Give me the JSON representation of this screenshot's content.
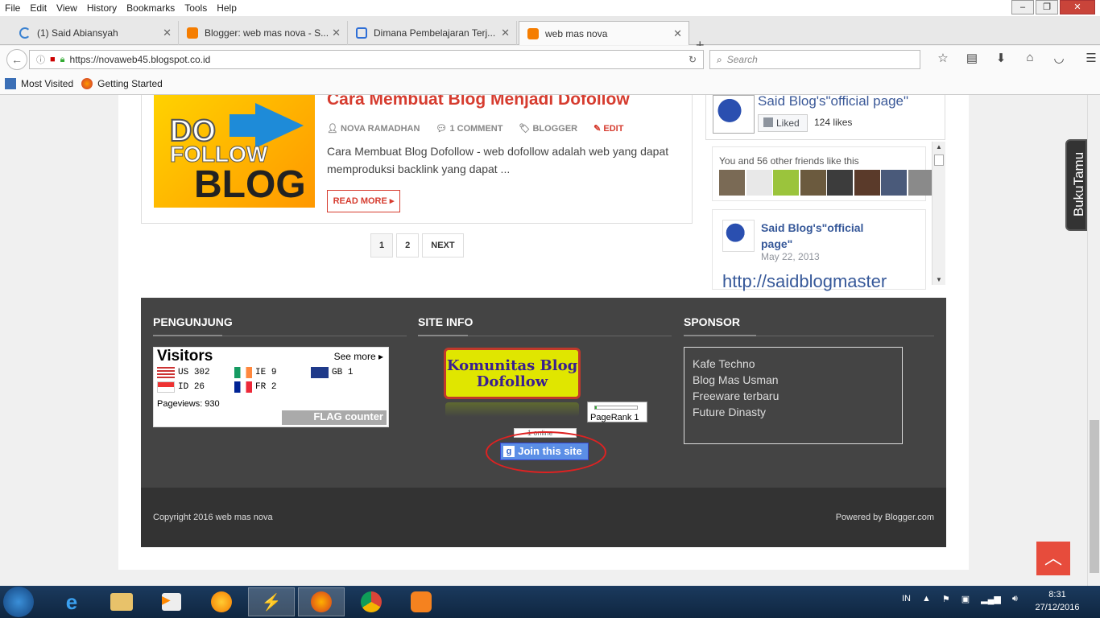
{
  "browser": {
    "menu": [
      "File",
      "Edit",
      "View",
      "History",
      "Bookmarks",
      "Tools",
      "Help"
    ],
    "tabs": [
      {
        "label": "(1) Said Abiansyah",
        "color": "#3b82d1"
      },
      {
        "label": "Blogger: web mas nova - S...",
        "color": "#f57d00"
      },
      {
        "label": "Dimana Pembelajaran Terj...",
        "color": "#2f6fd6"
      },
      {
        "label": "web mas nova",
        "color": "#f57d00"
      }
    ],
    "url": "https://novaweb45.blogspot.co.id",
    "search_placeholder": "Search",
    "bookmarks": [
      "Most Visited",
      "Getting Started"
    ]
  },
  "post": {
    "title": "Cara Membuat Blog Menjadi Dofollow",
    "thumb_text": [
      "DO",
      "FOLLOW",
      "BLOG"
    ],
    "author": "NOVA RAMADHAN",
    "comments": "1 COMMENT",
    "label": "BLOGGER",
    "edit": "EDIT",
    "excerpt": "Cara Membuat Blog Dofollow - web dofollow adalah web yang dapat memproduksi backlink yang dapat ...",
    "read_more": "READ MORE"
  },
  "pager": [
    "1",
    "2",
    "NEXT"
  ],
  "facebook": {
    "page_name": "Said Blog's\"official page\"",
    "liked": "Liked",
    "likes": "124 likes",
    "friends_text": "You and 56 other friends like this",
    "post_name": "Said Blog's\"official page\"",
    "post_date": "May 22, 2013",
    "post_link": "http://saidblogmaster"
  },
  "bukutamu": "BukuTamu",
  "footer": {
    "pengunjung": "PENGUNJUNG",
    "site_info": "SITE INFO",
    "sponsor": "SPONSOR",
    "visitors_title": "Visitors",
    "see_more": "See more",
    "visitors": [
      {
        "code": "US",
        "count": "302"
      },
      {
        "code": "IE",
        "count": "9"
      },
      {
        "code": "GB",
        "count": "1"
      },
      {
        "code": "ID",
        "count": "26"
      },
      {
        "code": "FR",
        "count": "2"
      }
    ],
    "pageviews": "Pageviews: 930",
    "flag_counter": "FLAG counter",
    "komunitas": [
      "Komunitas Blog",
      "Dofollow"
    ],
    "pagerank": "PageRank  1",
    "online": "1 online",
    "join": "Join this site",
    "sponsors": [
      "Kafe Techno",
      "Blog Mas Usman",
      "Freeware terbaru",
      "Future Dinasty"
    ],
    "copyright": "Copyright 2016 web mas nova",
    "powered": "Powered by Blogger.com"
  },
  "taskbar": {
    "lang": "IN",
    "time": "8:31",
    "date": "27/12/2016"
  }
}
